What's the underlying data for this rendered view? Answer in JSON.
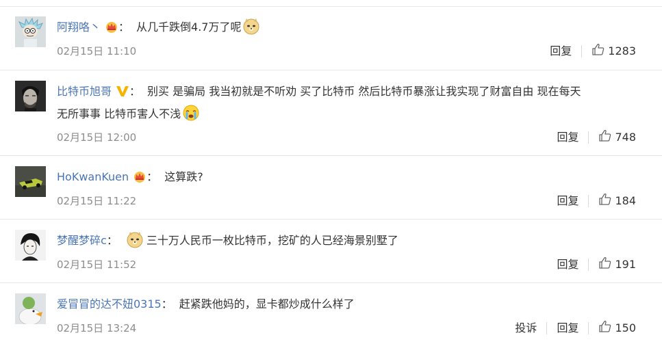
{
  "comments": [
    {
      "user": "阿翔咯丶",
      "badge": "crown-badge",
      "text": "从几千跌倒4.7万了呢",
      "text_cont": "",
      "emoji": "doge-emoji",
      "emoji_pos": "end",
      "time": "02月15日 11:10",
      "reply": "回复",
      "report": "",
      "likes": "1283"
    },
    {
      "user": "比特币旭哥",
      "badge": "verified-v-badge",
      "text": "别买 是骗局 我当初就是不听劝 买了比特币 然后比特币暴涨让我实现了财富自由 现在每天",
      "text_cont": "无所事事 比特币害人不浅",
      "emoji": "crying-emoji",
      "emoji_pos": "end",
      "time": "02月15日 12:00",
      "reply": "回复",
      "report": "",
      "likes": "748"
    },
    {
      "user": "HoKwanKuen",
      "badge": "crown-badge",
      "text": "这算跌?",
      "text_cont": "",
      "emoji": "",
      "emoji_pos": "",
      "time": "02月15日 11:22",
      "reply": "回复",
      "report": "",
      "likes": "184"
    },
    {
      "user": "梦醒梦碎c",
      "badge": "",
      "text": "三十万人民币一枚比特币，挖矿的人已经海景别墅了",
      "text_cont": "",
      "emoji": "doge-emoji",
      "emoji_pos": "start",
      "time": "02月15日 11:52",
      "reply": "回复",
      "report": "",
      "likes": "191"
    },
    {
      "user": "爱冒冒的达不妞0315",
      "badge": "",
      "text": "赶紧跌他妈的，显卡都炒成什么样了",
      "text_cont": "",
      "emoji": "",
      "emoji_pos": "",
      "time": "02月15日 13:24",
      "reply": "回复",
      "report": "投诉",
      "likes": "150"
    }
  ],
  "colon": "：",
  "colors": {
    "username": "#4a75b4",
    "meta": "#8c8c8c",
    "divider": "#e6e6e6"
  }
}
